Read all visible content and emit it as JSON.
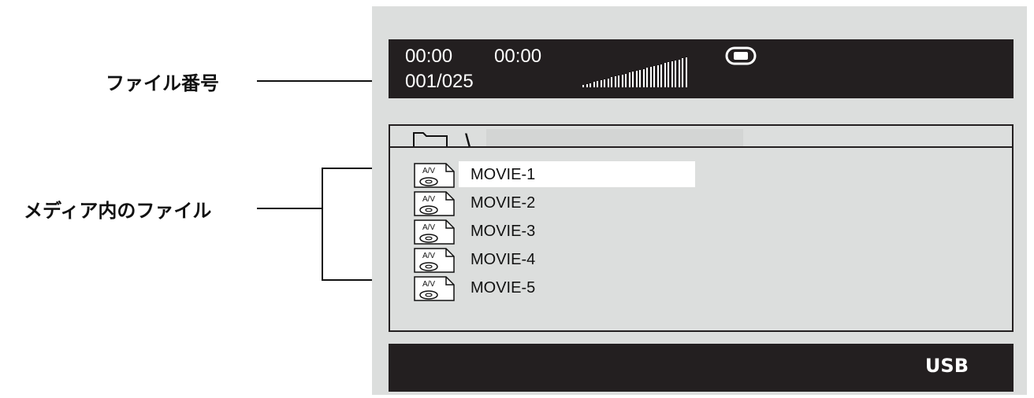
{
  "callouts": {
    "file_number": "ファイル番号",
    "media_files": "メディア内のファイル"
  },
  "status": {
    "elapsed_time": "00:00",
    "total_time": "00:00",
    "file_counter": "001/025",
    "volume_icon": "volume-bars-icon",
    "media_icon": "disc-icon"
  },
  "path": {
    "folder_icon": "folder-icon",
    "current": "\\"
  },
  "files": [
    {
      "name": "MOVIE-1",
      "icon": "av-file-icon",
      "icon_text": "A/V",
      "selected": true
    },
    {
      "name": "MOVIE-2",
      "icon": "av-file-icon",
      "icon_text": "A/V",
      "selected": false
    },
    {
      "name": "MOVIE-3",
      "icon": "av-file-icon",
      "icon_text": "A/V",
      "selected": false
    },
    {
      "name": "MOVIE-4",
      "icon": "av-file-icon",
      "icon_text": "A/V",
      "selected": false
    },
    {
      "name": "MOVIE-5",
      "icon": "av-file-icon",
      "icon_text": "A/V",
      "selected": false
    }
  ],
  "source": "USB",
  "colors": {
    "panel_background": "#dcdedd",
    "bar_background": "#231f20",
    "selection": "#ffffff"
  }
}
